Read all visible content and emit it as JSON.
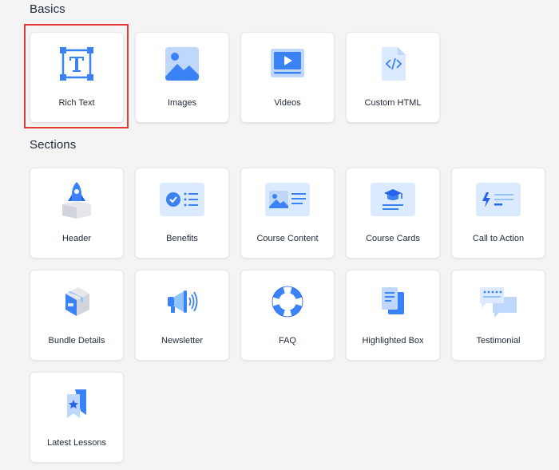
{
  "basics": {
    "title": "Basics",
    "items": [
      {
        "label": "Rich Text",
        "icon": "rich-text-icon"
      },
      {
        "label": "Images",
        "icon": "image-icon"
      },
      {
        "label": "Videos",
        "icon": "video-icon"
      },
      {
        "label": "Custom HTML",
        "icon": "code-file-icon"
      }
    ]
  },
  "sections": {
    "title": "Sections",
    "items": [
      {
        "label": "Header",
        "icon": "rocket-icon"
      },
      {
        "label": "Benefits",
        "icon": "badge-list-icon"
      },
      {
        "label": "Course Content",
        "icon": "image-text-icon"
      },
      {
        "label": "Course Cards",
        "icon": "graduation-cap-icon"
      },
      {
        "label": "Call to Action",
        "icon": "lightning-icon"
      },
      {
        "label": "Bundle Details",
        "icon": "box-icon"
      },
      {
        "label": "Newsletter",
        "icon": "megaphone-icon"
      },
      {
        "label": "FAQ",
        "icon": "lifebuoy-icon"
      },
      {
        "label": "Highlighted Box",
        "icon": "documents-icon"
      },
      {
        "label": "Testimonial",
        "icon": "chat-bubbles-icon"
      },
      {
        "label": "Latest Lessons",
        "icon": "bookmark-star-icon"
      }
    ]
  },
  "colors": {
    "accent": "#3b82f6",
    "accent_light": "#dbeafe",
    "selection": "#e53935"
  }
}
